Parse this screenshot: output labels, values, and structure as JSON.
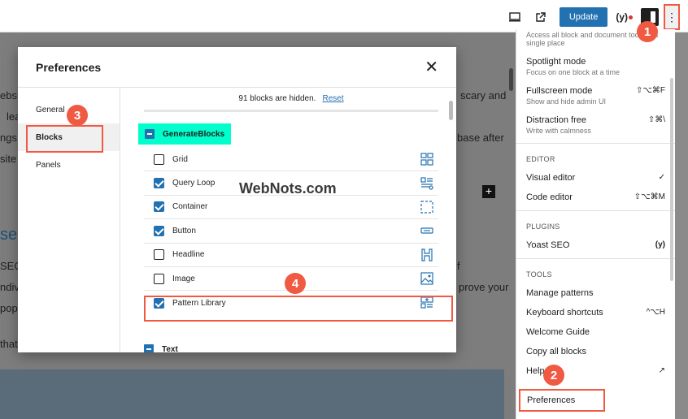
{
  "editor": {
    "top_actions": {
      "update_label": "Update",
      "yoast_label": "(y)",
      "more_glyph": "⋮"
    },
    "bg_lines": [
      "ebsi",
      "lea",
      "ngs",
      "site",
      "scary and",
      "base after",
      "se",
      "SEO",
      "ndiv",
      "pop",
      "that",
      "f",
      "prove your"
    ],
    "plus_glyph": "+"
  },
  "menu": {
    "top_item": {
      "label": "Access all block and document tools in a single place"
    },
    "view_items": [
      {
        "label": "Spotlight mode",
        "sub": "Focus on one block at a time",
        "shortcut": ""
      },
      {
        "label": "Fullscreen mode",
        "sub": "Show and hide admin UI",
        "shortcut": "⇧⌥⌘F"
      },
      {
        "label": "Distraction free",
        "sub": "Write with calmness",
        "shortcut": "⇧⌘\\"
      }
    ],
    "editor_heading": "EDITOR",
    "editor_items": [
      {
        "label": "Visual editor",
        "shortcut": "✓"
      },
      {
        "label": "Code editor",
        "shortcut": "⇧⌥⌘M"
      }
    ],
    "plugins_heading": "PLUGINS",
    "plugins_items": [
      {
        "label": "Yoast SEO",
        "shortcut": "(y)"
      }
    ],
    "tools_heading": "TOOLS",
    "tools_items": [
      {
        "label": "Manage patterns",
        "shortcut": ""
      },
      {
        "label": "Keyboard shortcuts",
        "shortcut": "^⌥H"
      },
      {
        "label": "Welcome Guide",
        "shortcut": ""
      },
      {
        "label": "Copy all blocks",
        "shortcut": ""
      },
      {
        "label": "Help",
        "shortcut": "↗"
      }
    ],
    "preferences_label": "Preferences"
  },
  "modal": {
    "title": "Preferences",
    "close_glyph": "✕",
    "tabs": [
      {
        "label": "General"
      },
      {
        "label": "Blocks"
      },
      {
        "label": "Panels"
      }
    ],
    "hidden_text": "91 blocks are hidden.",
    "reset_label": "Reset",
    "category_label": "GenerateBlocks",
    "blocks": [
      {
        "label": "Grid",
        "checked": false,
        "icon": "grid-icon"
      },
      {
        "label": "Query Loop",
        "checked": true,
        "icon": "query-loop-icon"
      },
      {
        "label": "Container",
        "checked": true,
        "icon": "container-icon"
      },
      {
        "label": "Button",
        "checked": true,
        "icon": "button-icon"
      },
      {
        "label": "Headline",
        "checked": false,
        "icon": "headline-icon"
      },
      {
        "label": "Image",
        "checked": false,
        "icon": "image-icon"
      },
      {
        "label": "Pattern Library",
        "checked": true,
        "icon": "pattern-library-icon"
      }
    ],
    "next_category_label": "Text"
  },
  "markers": [
    "1",
    "2",
    "3",
    "4"
  ],
  "watermark": "WebNots.com",
  "colors": {
    "accent": "#2271b1",
    "highlight": "#f05a43",
    "category_bg": "#00ffcc"
  }
}
